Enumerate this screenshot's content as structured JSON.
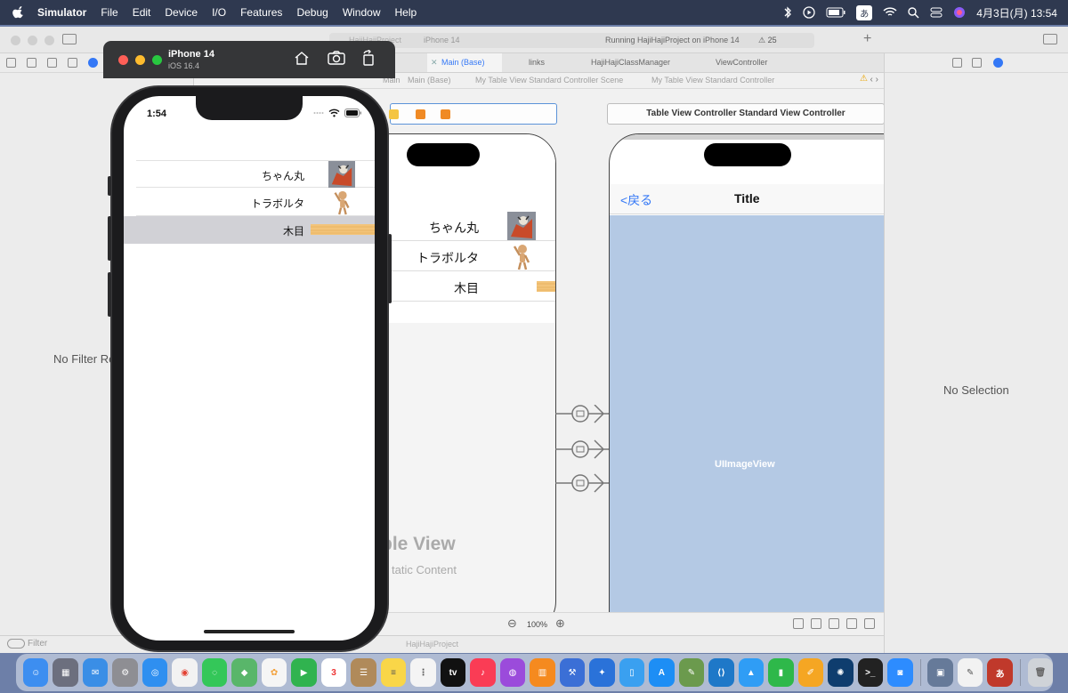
{
  "menubar": {
    "app_name": "Simulator",
    "items": [
      "File",
      "Edit",
      "Device",
      "I/O",
      "Features",
      "Debug",
      "Window",
      "Help"
    ],
    "ime_label": "あ",
    "clock": "4月3日(月)  13:54"
  },
  "xcode": {
    "project_name": "HajiHajiProject",
    "device": "iPhone 14",
    "status_text": "Running HajiHajiProject on iPhone 14",
    "warning_count": "25",
    "tabs": [
      "Main (Base)",
      "links",
      "HajiHajiClassManager",
      "ViewController"
    ],
    "breadcrumb": [
      "Main",
      "Main (Base)",
      "My Table View Standard Controller Scene",
      "My Table View Standard Controller"
    ],
    "navigator_empty": "No Filter Re",
    "filter_placeholder": "Filter",
    "debug_project": "HajiHajiProject",
    "inspector_empty": "No Selection",
    "zoom_level": "100%"
  },
  "storyboard": {
    "left_scene": {
      "rows": [
        {
          "label": "ちゃん丸",
          "image": "dog-photo"
        },
        {
          "label": "トラボルタ",
          "image": "wooden-mannequin"
        },
        {
          "label": "木目",
          "image": "wood-grain"
        }
      ],
      "big_title": "ble View",
      "subtitle": "tatic Content"
    },
    "right_scene": {
      "header": "Table View Controller Standard View Controller",
      "back_label": "<戻る",
      "nav_title": "Title",
      "image_view_label": "UIImageView"
    }
  },
  "simulator": {
    "device_name": "iPhone 14",
    "os_version": "iOS 16.4",
    "time": "1:54",
    "rows": [
      {
        "label": "ちゃん丸",
        "image": "dog-photo",
        "selected": false
      },
      {
        "label": "トラボルタ",
        "image": "wooden-mannequin",
        "selected": false
      },
      {
        "label": "木目",
        "image": "wood-grain",
        "selected": true
      }
    ]
  },
  "colors": {
    "accent": "#3478f6",
    "image_view_bg": "#b4c9e4",
    "selected_row": "#d1d1d6",
    "wood": "#f3c47a"
  }
}
